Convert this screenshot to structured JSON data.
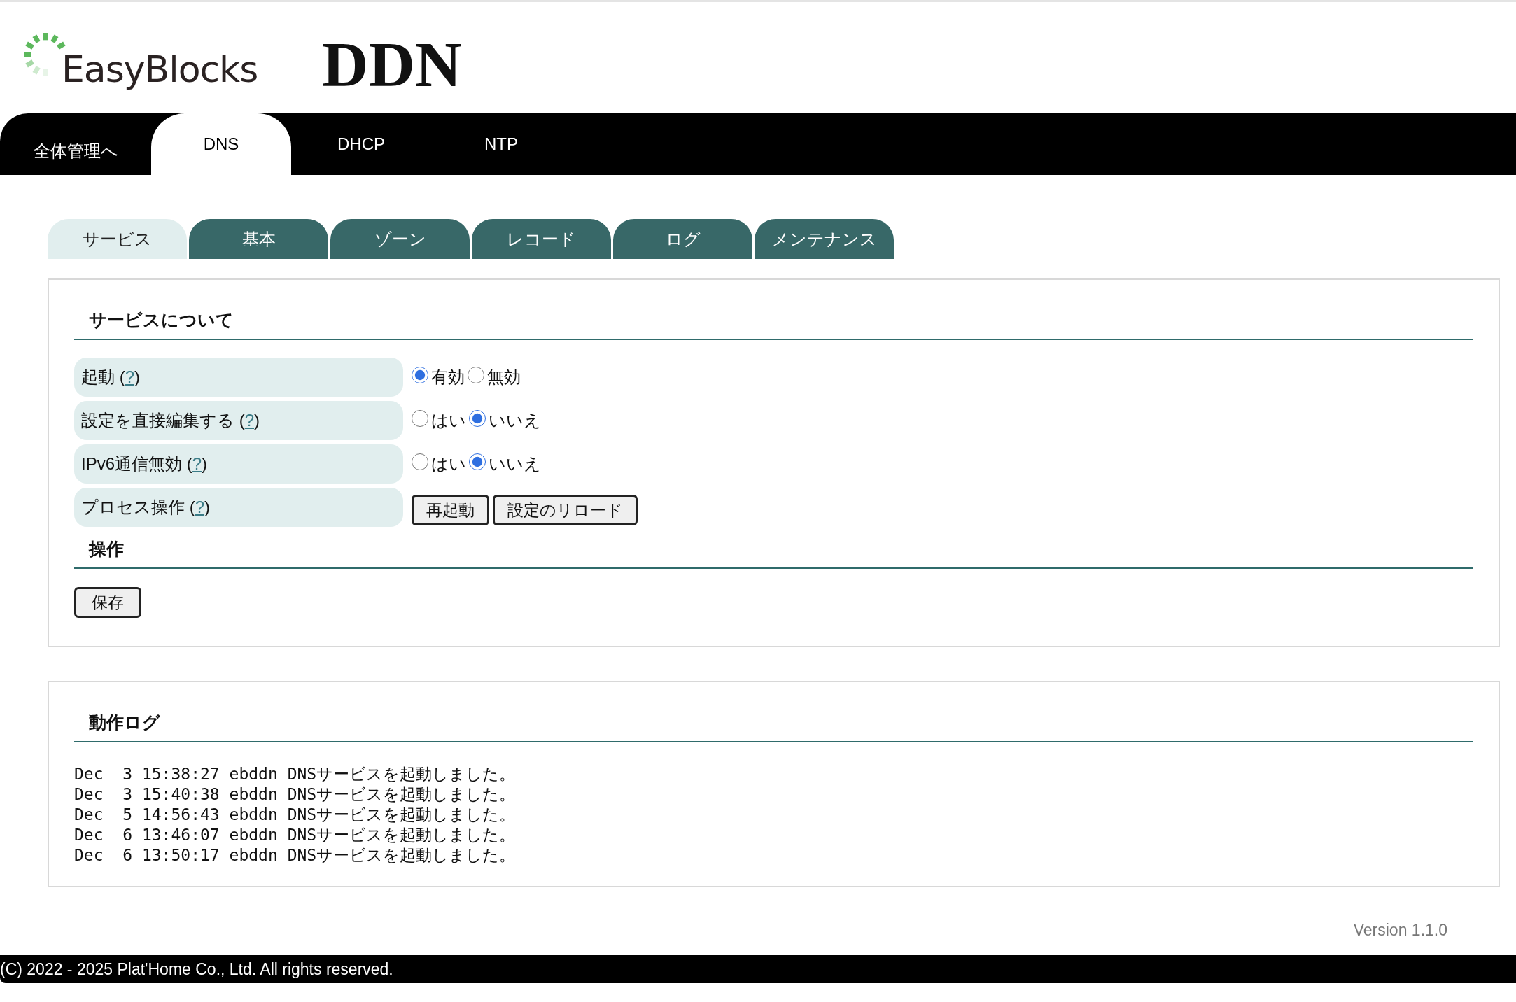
{
  "header": {
    "logo_text": "EasyBlocks",
    "title": "DDN"
  },
  "main_nav": [
    {
      "label": "全体管理へ",
      "selected": false
    },
    {
      "label": "DNS",
      "selected": true
    },
    {
      "label": "DHCP",
      "selected": false
    },
    {
      "label": "NTP",
      "selected": false
    }
  ],
  "sub_tabs": [
    {
      "label": "サービス",
      "selected": true
    },
    {
      "label": "基本",
      "selected": false
    },
    {
      "label": "ゾーン",
      "selected": false
    },
    {
      "label": "レコード",
      "selected": false
    },
    {
      "label": "ログ",
      "selected": false
    },
    {
      "label": "メンテナンス",
      "selected": false
    }
  ],
  "service_section": {
    "title": "サービスについて",
    "rows": [
      {
        "kind": "radio",
        "label": "起動 (",
        "help": "?",
        "label_end": ")",
        "options": [
          {
            "label": "有効",
            "selected": true
          },
          {
            "label": "無効",
            "selected": false
          }
        ]
      },
      {
        "kind": "radio",
        "label": "設定を直接編集する (",
        "help": "?",
        "label_end": ")",
        "options": [
          {
            "label": "はい",
            "selected": false
          },
          {
            "label": "いいえ",
            "selected": true
          }
        ]
      },
      {
        "kind": "radio",
        "label": "IPv6通信無効 (",
        "help": "?",
        "label_end": ")",
        "options": [
          {
            "label": "はい",
            "selected": false
          },
          {
            "label": "いいえ",
            "selected": true
          }
        ]
      },
      {
        "kind": "buttons",
        "label": "プロセス操作 (",
        "help": "?",
        "label_end": ")",
        "buttons": [
          "再起動",
          "設定のリロード"
        ]
      }
    ]
  },
  "operation_section": {
    "title": "操作",
    "buttons": [
      "保存"
    ]
  },
  "log_section": {
    "title": "動作ログ",
    "lines": [
      "Dec  3 15:38:27 ebddn DNSサービスを起動しました。",
      "Dec  3 15:40:38 ebddn DNSサービスを起動しました。",
      "Dec  5 14:56:43 ebddn DNSサービスを起動しました。",
      "Dec  6 13:46:07 ebddn DNSサービスを起動しました。",
      "Dec  6 13:50:17 ebddn DNSサービスを起動しました。"
    ]
  },
  "version": "Version 1.1.0",
  "copyright": "(C) 2022 - 2025 Plat'Home Co., Ltd. All rights reserved."
}
